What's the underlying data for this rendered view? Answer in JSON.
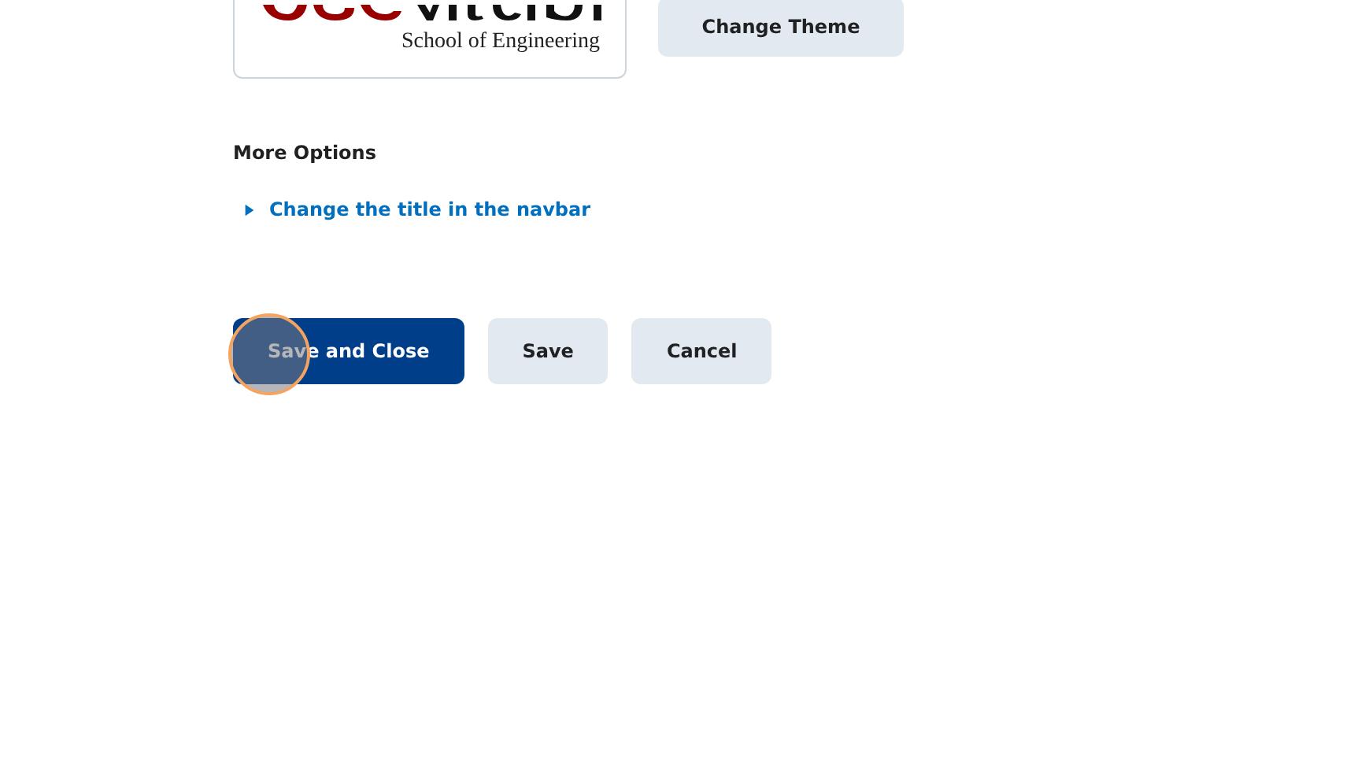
{
  "logo": {
    "subtitle": "School of Engineering"
  },
  "theme_button": "Change Theme",
  "more_options": {
    "heading": "More Options",
    "items": [
      {
        "label": "Change the title in the navbar",
        "expanded": false
      }
    ]
  },
  "buttons": [
    {
      "label": "Save and Close",
      "kind": "primary"
    },
    {
      "label": "Save",
      "kind": "secondary"
    },
    {
      "label": "Cancel",
      "kind": "secondary"
    }
  ],
  "click_indicator": {
    "on": true
  }
}
